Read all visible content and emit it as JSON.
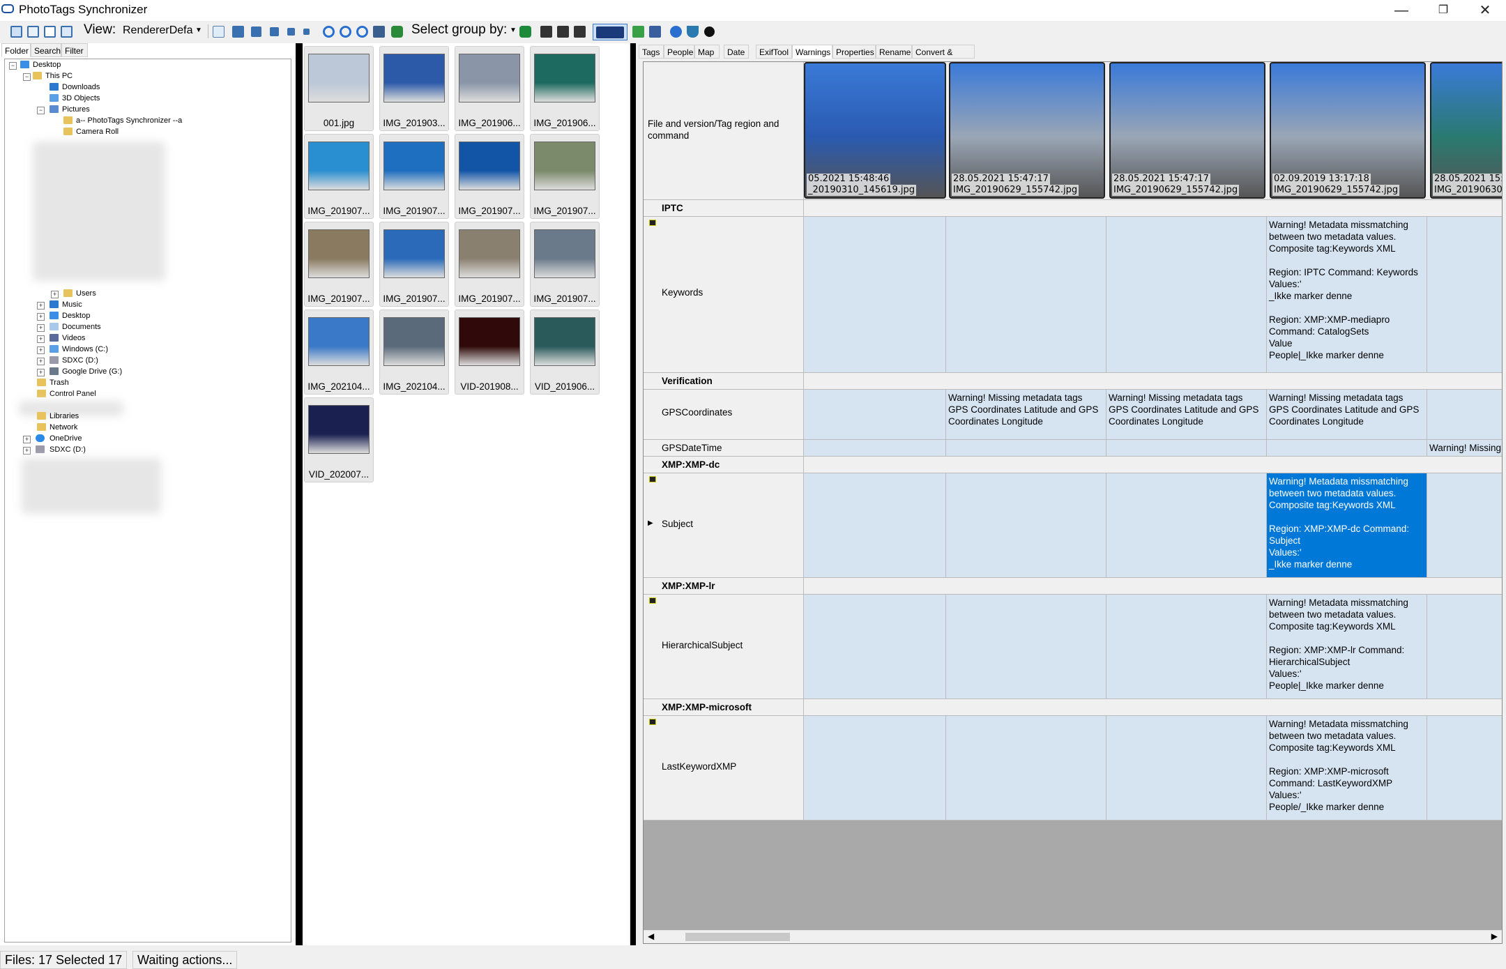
{
  "window": {
    "title": "PhotoTags Synchronizer",
    "min": "—",
    "max": "❐",
    "close": "✕"
  },
  "toolbar": {
    "view_label": "View:",
    "view_value": "RendererDefa",
    "group_label": "Select group by:"
  },
  "left_tabs": [
    "Folder",
    "Search",
    "Filter"
  ],
  "tree": {
    "desktop": "Desktop",
    "this_pc": "This PC",
    "downloads": "Downloads",
    "objects3d": "3D Objects",
    "pictures": "Pictures",
    "pts_folder": "a-- PhotoTags Synchronizer --a",
    "camera_roll": "Camera Roll",
    "users": "Users",
    "music": "Music",
    "desktop2": "Desktop",
    "documents": "Documents",
    "videos": "Videos",
    "windows_c": "Windows (C:)",
    "sdxc_d": "SDXC (D:)",
    "gdrive": "Google Drive (G:)",
    "trash": "Trash",
    "control_panel": "Control Panel",
    "libraries": "Libraries",
    "network": "Network",
    "onedrive": "OneDrive",
    "sdxc_d2": "SDXC (D:)"
  },
  "thumbnails": [
    {
      "caption": "001.jpg",
      "color": "#bcc8d8"
    },
    {
      "caption": "IMG_201903...",
      "color": "#2c5aa8"
    },
    {
      "caption": "IMG_201906...",
      "color": "#8a96a8"
    },
    {
      "caption": "IMG_201906...",
      "color": "#1d6b60"
    },
    {
      "caption": "IMG_201907...",
      "color": "#2a8fd0"
    },
    {
      "caption": "IMG_201907...",
      "color": "#1e6fc0"
    },
    {
      "caption": "IMG_201907...",
      "color": "#1255a6"
    },
    {
      "caption": "IMG_201907...",
      "color": "#7a8a6a"
    },
    {
      "caption": "IMG_201907...",
      "color": "#8a7a60"
    },
    {
      "caption": "IMG_201907...",
      "color": "#2a6ab8"
    },
    {
      "caption": "IMG_201907...",
      "color": "#8a8070"
    },
    {
      "caption": "IMG_201907...",
      "color": "#6a7a8a"
    },
    {
      "caption": "IMG_202104...",
      "color": "#3a78c8"
    },
    {
      "caption": "IMG_202104...",
      "color": "#5a6a7a"
    },
    {
      "caption": "VID-201908...",
      "color": "#300a0a"
    },
    {
      "caption": "VID_201906...",
      "color": "#2a5a5a"
    },
    {
      "caption": "VID_202007...",
      "color": "#1a2050"
    }
  ],
  "right_tabs": [
    "Tags",
    "People",
    "Map",
    "Date",
    "ExifTool",
    "Warnings",
    "Properties",
    "Rename",
    "Convert & Merge"
  ],
  "grid": {
    "header_label": "File and version/Tag region and command",
    "photos": [
      {
        "line1": "05.2021 15:48:46",
        "line2": "_20190310_145619.jpg",
        "color": "#2a5ab0"
      },
      {
        "line1": "28.05.2021 15:47:17",
        "line2": "IMG_20190629_155742.jpg",
        "color": "#9aa6b6"
      },
      {
        "line1": "28.05.2021 15:47:17",
        "line2": "IMG_20190629_155742.jpg",
        "color": "#9aa6b6"
      },
      {
        "line1": "02.09.2019 13:17:18",
        "line2": "IMG_20190629_155742.jpg",
        "color": "#9aa6b6"
      },
      {
        "line1": "28.05.2021 15:",
        "line2": "IMG_20190630_",
        "color": "#2a7a70"
      }
    ],
    "groups": {
      "iptc": "IPTC",
      "verification": "Verification",
      "xmp_dc": "XMP:XMP-dc",
      "xmp_lr": "XMP:XMP-lr",
      "xmp_ms": "XMP:XMP-microsoft"
    },
    "rows": {
      "keywords": "Keywords",
      "gps_coords": "GPSCoordinates",
      "gps_datetime": "GPSDateTime",
      "subject": "Subject",
      "hier_subject": "HierarchicalSubject",
      "last_kw": "LastKeywordXMP"
    },
    "cells": {
      "keywords_c4": "Warning! Metadata missmatching between two metadata values.\nComposite tag:Keywords XML\n\nRegion: IPTC Command: Keywords\nValues:'\n_Ikke marker denne\n\nRegion: XMP:XMP-mediapro Command: CatalogSets\nValue\nPeople|_Ikke marker denne",
      "gps_c2": "Warning! Missing metadata tags\nGPS Coordinates Latitude and GPS Coordinates Longitude",
      "gps_c3": "Warning! Missing metadata tags\nGPS Coordinates Latitude and GPS Coordinates Longitude",
      "gps_c4": "Warning! Missing metadata tags\nGPS Coordinates Latitude and GPS Coordinates Longitude",
      "gpsdt_c5": "Warning! Missing",
      "subject_c4": "Warning! Metadata missmatching between two metadata values.\nComposite tag:Keywords XML\n\nRegion: XMP:XMP-dc Command: Subject\nValues:'\n_Ikke marker denne",
      "hier_c4": "Warning! Metadata missmatching between two metadata values.\nComposite tag:Keywords XML\n\nRegion: XMP:XMP-lr Command: HierarchicalSubject\nValues:'\nPeople|_Ikke marker denne",
      "lastkw_c4": "Warning! Metadata missmatching between two metadata values.\nComposite tag:Keywords XML\n\nRegion: XMP:XMP-microsoft Command: LastKeywordXMP\nValues:'\nPeople/_Ikke marker denne"
    }
  },
  "status": {
    "files": "Files: 17 Selected 17",
    "message": "Waiting actions..."
  },
  "colors": {
    "accent": "#0078d7",
    "cell_bg": "#d6e4f2",
    "grid_empty": "#a9a9a9"
  }
}
